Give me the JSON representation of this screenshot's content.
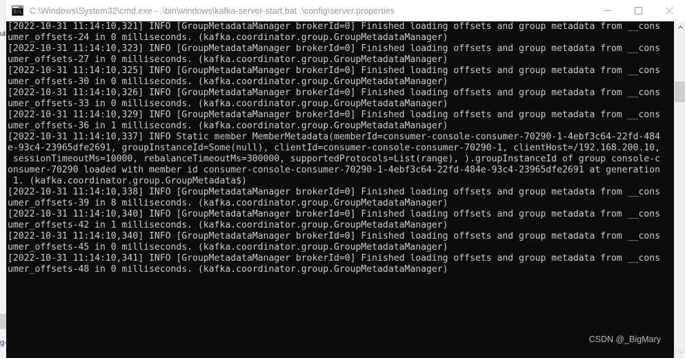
{
  "window": {
    "title": "C:\\Windows\\System32\\cmd.exe - .\\bin\\windows\\kafka-server-start.bat  .\\config\\server.properties",
    "icon": "cmd-console-icon",
    "icon_prompt_text": "C:\\",
    "controls": {
      "minimize_label": "Minimize",
      "maximize_label": "Maximize",
      "close_label": "Close"
    },
    "titlebar_bg": "#ffffff",
    "title_color": "#9a9a9a"
  },
  "console": {
    "background": "#0c0c0c",
    "foreground": "#cccccc",
    "lines": [
      "[2022-10-31 11:14:10,321] INFO [GroupMetadataManager brokerId=0] Finished loading offsets and group metadata from __cons",
      "umer_offsets-24 in 0 milliseconds. (kafka.coordinator.group.GroupMetadataManager)",
      "[2022-10-31 11:14:10,323] INFO [GroupMetadataManager brokerId=0] Finished loading offsets and group metadata from __cons",
      "umer_offsets-27 in 0 milliseconds. (kafka.coordinator.group.GroupMetadataManager)",
      "[2022-10-31 11:14:10,325] INFO [GroupMetadataManager brokerId=0] Finished loading offsets and group metadata from __cons",
      "umer_offsets-30 in 0 milliseconds. (kafka.coordinator.group.GroupMetadataManager)",
      "[2022-10-31 11:14:10,326] INFO [GroupMetadataManager brokerId=0] Finished loading offsets and group metadata from __cons",
      "umer_offsets-33 in 0 milliseconds. (kafka.coordinator.group.GroupMetadataManager)",
      "[2022-10-31 11:14:10,329] INFO [GroupMetadataManager brokerId=0] Finished loading offsets and group metadata from __cons",
      "umer_offsets-36 in 1 milliseconds. (kafka.coordinator.group.GroupMetadataManager)",
      "[2022-10-31 11:14:10,337] INFO Static member MemberMetadata(memberId=consumer-console-consumer-70290-1-4ebf3c64-22fd-484",
      "e-93c4-23965dfe2691, groupInstanceId=Some(null), clientId=consumer-console-consumer-70290-1, clientHost=/192.168.200.10,",
      " sessionTimeoutMs=10000, rebalanceTimeoutMs=300000, supportedProtocols=List(range), ).groupInstanceId of group console-c",
      "onsumer-70290 loaded with member id consumer-console-consumer-70290-1-4ebf3c64-22fd-484e-93c4-23965dfe2691 at generation",
      " 1. (kafka.coordinator.group.GroupMetadata$)",
      "[2022-10-31 11:14:10,338] INFO [GroupMetadataManager brokerId=0] Finished loading offsets and group metadata from __cons",
      "umer_offsets-39 in 8 milliseconds. (kafka.coordinator.group.GroupMetadataManager)",
      "[2022-10-31 11:14:10,340] INFO [GroupMetadataManager brokerId=0] Finished loading offsets and group metadata from __cons",
      "umer_offsets-42 in 1 milliseconds. (kafka.coordinator.group.GroupMetadataManager)",
      "[2022-10-31 11:14:10,340] INFO [GroupMetadataManager brokerId=0] Finished loading offsets and group metadata from __cons",
      "umer_offsets-45 in 0 milliseconds. (kafka.coordinator.group.GroupMetadataManager)",
      "[2022-10-31 11:14:10,341] INFO [GroupMetadataManager brokerId=0] Finished loading offsets and group metadata from __cons",
      "umer_offsets-48 in 0 milliseconds. (kafka.coordinator.group.GroupMetadataManager)"
    ],
    "text": "[2022-10-31 11:14:10,321] INFO [GroupMetadataManager brokerId=0] Finished loading offsets and group metadata from __cons\numer_offsets-24 in 0 milliseconds. (kafka.coordinator.group.GroupMetadataManager)\n[2022-10-31 11:14:10,323] INFO [GroupMetadataManager brokerId=0] Finished loading offsets and group metadata from __cons\numer_offsets-27 in 0 milliseconds. (kafka.coordinator.group.GroupMetadataManager)\n[2022-10-31 11:14:10,325] INFO [GroupMetadataManager brokerId=0] Finished loading offsets and group metadata from __cons\numer_offsets-30 in 0 milliseconds. (kafka.coordinator.group.GroupMetadataManager)\n[2022-10-31 11:14:10,326] INFO [GroupMetadataManager brokerId=0] Finished loading offsets and group metadata from __cons\numer_offsets-33 in 0 milliseconds. (kafka.coordinator.group.GroupMetadataManager)\n[2022-10-31 11:14:10,329] INFO [GroupMetadataManager brokerId=0] Finished loading offsets and group metadata from __cons\numer_offsets-36 in 1 milliseconds. (kafka.coordinator.group.GroupMetadataManager)\n[2022-10-31 11:14:10,337] INFO Static member MemberMetadata(memberId=consumer-console-consumer-70290-1-4ebf3c64-22fd-484\ne-93c4-23965dfe2691, groupInstanceId=Some(null), clientId=consumer-console-consumer-70290-1, clientHost=/192.168.200.10,\n sessionTimeoutMs=10000, rebalanceTimeoutMs=300000, supportedProtocols=List(range), ).groupInstanceId of group console-c\nonsumer-70290 loaded with member id consumer-console-consumer-70290-1-4ebf3c64-22fd-484e-93c4-23965dfe2691 at generation\n 1. (kafka.coordinator.group.GroupMetadata$)\n[2022-10-31 11:14:10,338] INFO [GroupMetadataManager brokerId=0] Finished loading offsets and group metadata from __cons\numer_offsets-39 in 8 milliseconds. (kafka.coordinator.group.GroupMetadataManager)\n[2022-10-31 11:14:10,340] INFO [GroupMetadataManager brokerId=0] Finished loading offsets and group metadata from __cons\numer_offsets-42 in 1 milliseconds. (kafka.coordinator.group.GroupMetadataManager)\n[2022-10-31 11:14:10,340] INFO [GroupMetadataManager brokerId=0] Finished loading offsets and group metadata from __cons\numer_offsets-45 in 0 milliseconds. (kafka.coordinator.group.GroupMetadataManager)\n[2022-10-31 11:14:10,341] INFO [GroupMetadataManager brokerId=0] Finished loading offsets and group metadata from __cons\numer_offsets-48 in 0 milliseconds. (kafka.coordinator.group.GroupMetadataManager)"
  },
  "scrollbar": {
    "up_arrow": "▲",
    "down_arrow": "▼",
    "thumb_color": "#cdcdcd",
    "track_color": "#f0f0f0"
  },
  "watermark": {
    "text": "CSDN @_BigMary"
  },
  "background_window": {
    "glyph_bottom": "g-",
    "glyph_top": "ub"
  }
}
